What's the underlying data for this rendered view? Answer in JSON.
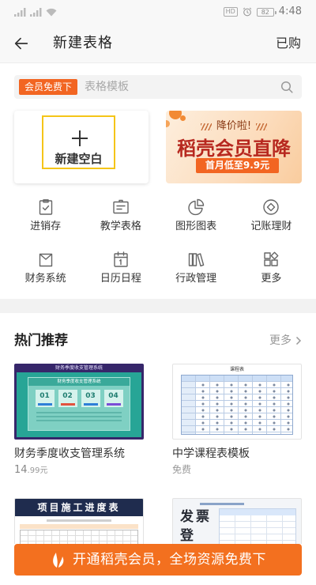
{
  "status_bar": {
    "network_label": "HD",
    "battery_level": "82",
    "time": "4:48",
    "icons": [
      "signal-icon",
      "wifi-icon",
      "alarm-icon",
      "battery-icon"
    ]
  },
  "header": {
    "back_icon": "back-arrow-icon",
    "title": "新建表格",
    "purchased_label": "已购"
  },
  "search": {
    "badge": "会员免费下",
    "placeholder": "表格模板",
    "icon": "search-icon"
  },
  "create_blank": {
    "label": "新建空白",
    "icon": "plus-icon"
  },
  "promo_banner": {
    "tag": "降价啦!",
    "headline": "稻壳会员直降",
    "offer": "首月低至9.9元"
  },
  "categories": [
    {
      "label": "进销存",
      "icon": "clipboard-check-icon"
    },
    {
      "label": "教学表格",
      "icon": "teaching-board-icon"
    },
    {
      "label": "图形图表",
      "icon": "pie-chart-icon"
    },
    {
      "label": "记账理财",
      "icon": "coin-icon"
    },
    {
      "label": "财务系统",
      "icon": "shopping-bag-icon"
    },
    {
      "label": "日历日程",
      "icon": "calendar-icon"
    },
    {
      "label": "行政管理",
      "icon": "books-icon"
    },
    {
      "label": "更多",
      "icon": "more-grid-icon"
    }
  ],
  "recommend": {
    "title": "热门推荐",
    "more_label": "更多",
    "more_icon": "chevron-right-icon"
  },
  "templates": [
    {
      "name": "财务季度收支管理系统",
      "price_main": "14",
      "price_sub": ".99元",
      "thumb": {
        "title": "财务季度收支管理系统",
        "panel_title": "财务季度收支管理系统",
        "steps": [
          "01",
          "02",
          "03",
          "04"
        ]
      }
    },
    {
      "name": "中学课程表模板",
      "price": "免费",
      "thumb": {
        "title": "课程表"
      }
    },
    {
      "thumb": {
        "title": "项目施工进度表"
      }
    },
    {
      "thumb": {
        "title_line1": "发票",
        "title_line2": "登"
      }
    }
  ],
  "bottom_cta": {
    "label": "开通稻壳会员，全场资源免费下",
    "icon": "leaf-icon"
  },
  "colors": {
    "accent": "#f3701f",
    "badge": "#f26522",
    "promo_headline": "#b7281f",
    "blank_border": "#f5c518"
  }
}
